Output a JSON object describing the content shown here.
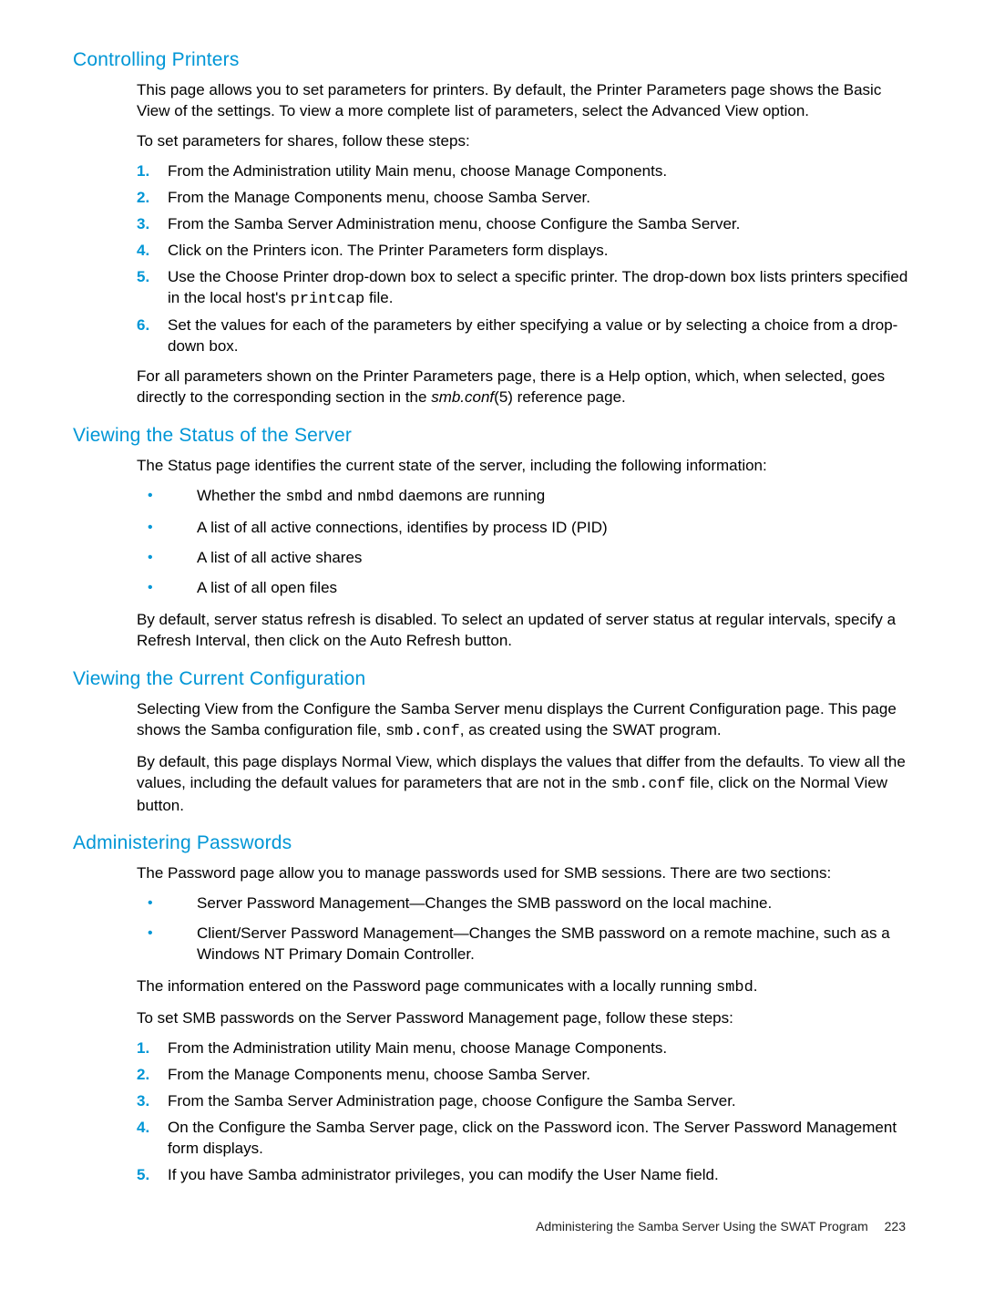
{
  "sections": {
    "controllingPrinters": {
      "heading": "Controlling Printers",
      "intro": "This page allows you to set parameters for printers. By default, the Printer Parameters page shows the Basic View of the settings. To view a more complete list of parameters, select the Advanced View option.",
      "lead": "To set parameters for shares, follow these steps:",
      "steps": [
        "From the Administration utility Main menu, choose Manage Components.",
        "From the Manage Components menu, choose Samba Server.",
        "From the Samba Server Administration menu, choose Configure the Samba Server.",
        "Click on the Printers icon. The Printer Parameters form displays.",
        {
          "pre": "Use the Choose Printer drop-down box to select a specific printer. The drop-down box lists printers specified in the local host's ",
          "code": "printcap",
          "post": " file."
        },
        "Set the values for each of the parameters by either specifying a value or by selecting a choice from a drop-down box."
      ],
      "outro_pre": "For all parameters shown on the Printer Parameters page, there is a Help option, which, when selected, goes directly to the corresponding section in the ",
      "outro_em": "smb.conf",
      "outro_post": "(5) reference page."
    },
    "viewingStatus": {
      "heading": "Viewing the Status of the Server",
      "intro": "The Status page identifies the current state of the server, including the following information:",
      "bullets": [
        {
          "pre": "Whether the ",
          "code1": "smbd",
          "mid": " and ",
          "code2": "nmbd",
          "post": " daemons are running"
        },
        "A list of all active connections, identifies by process ID (PID)",
        "A list of all active shares",
        "A list of all open files"
      ],
      "outro": "By default, server status refresh is disabled. To select an updated of server status at regular intervals, specify a Refresh Interval, then click on the Auto Refresh button."
    },
    "viewingConfig": {
      "heading": "Viewing the Current Configuration",
      "p1_pre": "Selecting View from the Configure the Samba Server menu displays the Current Configuration page. This page shows the Samba configuration file, ",
      "p1_code": "smb.conf",
      "p1_post": ", as created using the SWAT program.",
      "p2_pre": "By default, this page displays Normal View, which displays the values that differ from the defaults. To view all the values, including the default values for parameters that are not in the ",
      "p2_code": "smb.conf",
      "p2_post": " file, click on the Normal View button."
    },
    "adminPasswords": {
      "heading": "Administering Passwords",
      "intro": "The Password page allow you to manage passwords used for SMB sessions. There are two sections:",
      "bullets": [
        "Server Password Management—Changes the SMB password on the local machine.",
        "Client/Server Password Management—Changes the SMB password on a remote machine, such as a Windows NT Primary Domain Controller."
      ],
      "p_after_pre": "The information entered on the Password page communicates with a locally running ",
      "p_after_code": "smbd",
      "p_after_post": ".",
      "lead": "To set SMB passwords on the Server Password Management page, follow these steps:",
      "steps": [
        "From the Administration utility Main menu, choose Manage Components.",
        "From the Manage Components menu, choose Samba Server.",
        "From the Samba Server Administration page, choose Configure the Samba Server.",
        "On the Configure the Samba Server page, click on the Password icon. The Server Password Management form displays.",
        "If you have Samba administrator privileges, you can modify the User Name field."
      ]
    }
  },
  "footer": {
    "text": "Administering the Samba Server Using the SWAT Program",
    "page": "223"
  },
  "numbers": {
    "1": "1",
    "2": "2",
    "3": "3",
    "4": "4",
    "5": "5",
    "6": "6"
  },
  "bullet": "•"
}
